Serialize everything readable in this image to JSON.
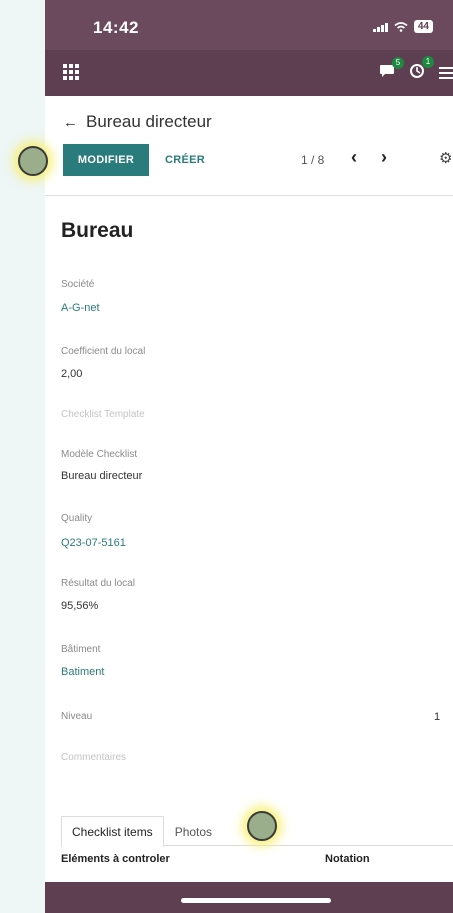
{
  "status_bar": {
    "time": "14:42",
    "battery": "44"
  },
  "nav": {
    "chat_count": "5",
    "activity_count": "1"
  },
  "control_panel": {
    "breadcrumb": "Bureau directeur",
    "edit_label": "MODIFIER",
    "create_label": "CRÉER",
    "pager": "1 / 8"
  },
  "record": {
    "title": "Bureau",
    "fields": [
      {
        "label": "Société",
        "value": "A-G-net"
      },
      {
        "label": "Coefficient du local",
        "value": "2,00"
      },
      {
        "label": "Checklist Template",
        "value": ""
      },
      {
        "label": "Modèle Checklist",
        "value": "Bureau directeur"
      },
      {
        "label": "Quality",
        "value": "Q23-07-5161"
      },
      {
        "label": "Résultat du local",
        "value": "95,56%"
      },
      {
        "label": "Bâtiment",
        "value": "Batiment"
      },
      {
        "label": "Niveau",
        "value": "1"
      },
      {
        "label": "Commentaires",
        "value": ""
      }
    ]
  },
  "tabs": [
    {
      "label": "Checklist items",
      "active": true
    },
    {
      "label": "Photos",
      "active": false
    }
  ],
  "table": {
    "columns": [
      "Eléments à controler",
      "Notation"
    ]
  },
  "colors": {
    "header": "#5e3f52",
    "primary": "#2a7b7b",
    "touch_highlight": "#f6f06e"
  },
  "icons": [
    "back-arrow-icon",
    "apps-grid-icon",
    "chat-icon",
    "activity-icon",
    "menu-icon",
    "gear-icon",
    "chevron-left-icon",
    "chevron-right-icon",
    "signal-icon",
    "wifi-icon",
    "battery-icon"
  ]
}
